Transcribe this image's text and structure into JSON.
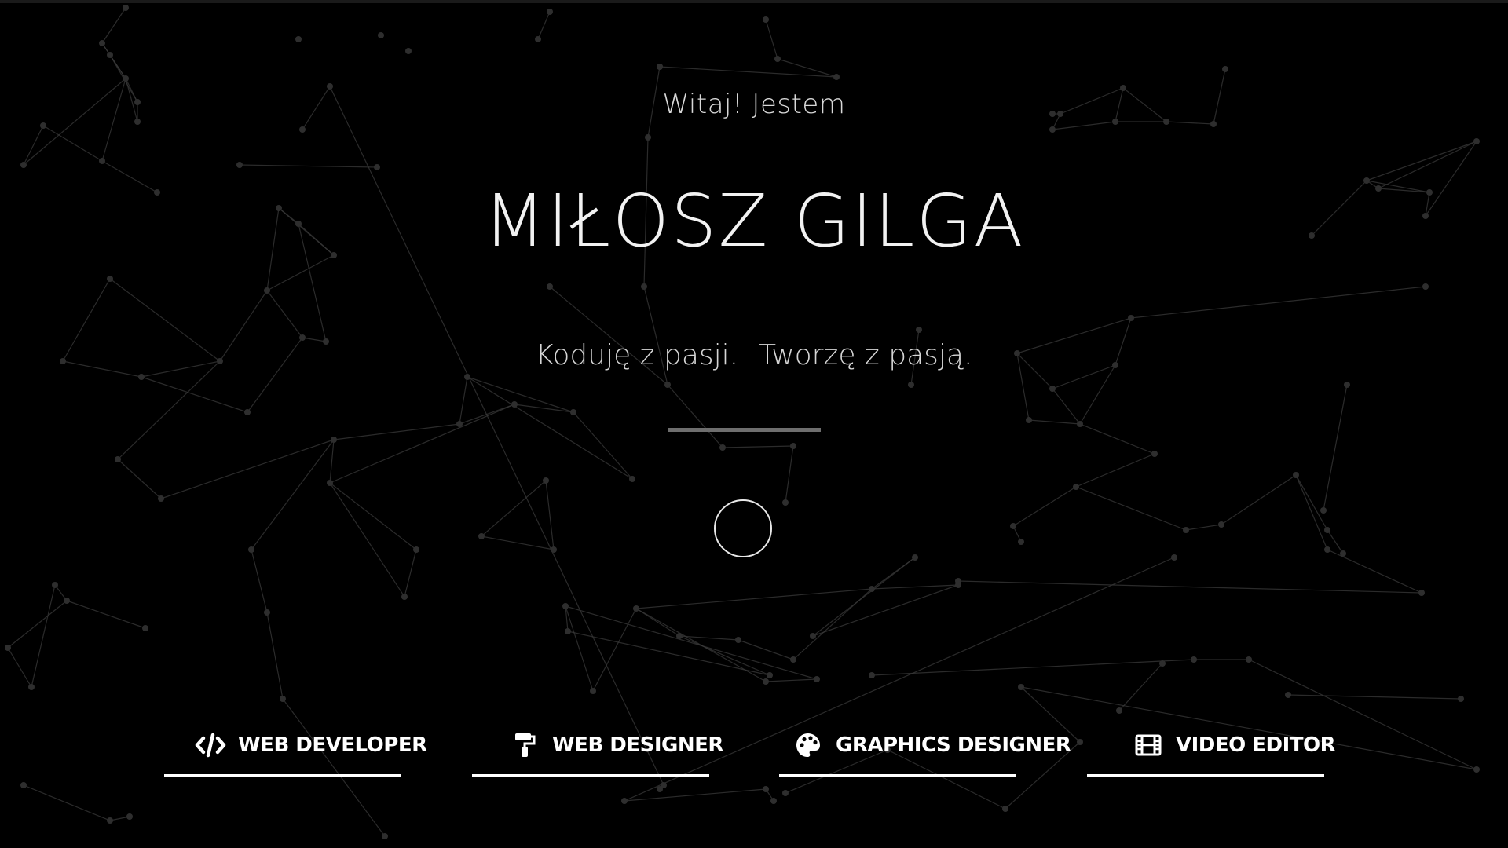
{
  "hero": {
    "greeting": "Witaj! Jestem",
    "name": "MIŁOSZ GILGA",
    "tagline_part1": "Koduję z pasji.",
    "tagline_part2": "Tworzę z pasją."
  },
  "roles": [
    {
      "label": "WEB DEVELOPER",
      "icon": "code-icon"
    },
    {
      "label": "WEB DESIGNER",
      "icon": "paint-roller-icon"
    },
    {
      "label": "GRAPHICS DESIGNER",
      "icon": "palette-icon"
    },
    {
      "label": "VIDEO EDITOR",
      "icon": "film-icon"
    }
  ],
  "colors": {
    "background": "#000000",
    "text": "#ffffff",
    "network_lines": "#3a3a3a",
    "divider": "#6e6e6e"
  }
}
